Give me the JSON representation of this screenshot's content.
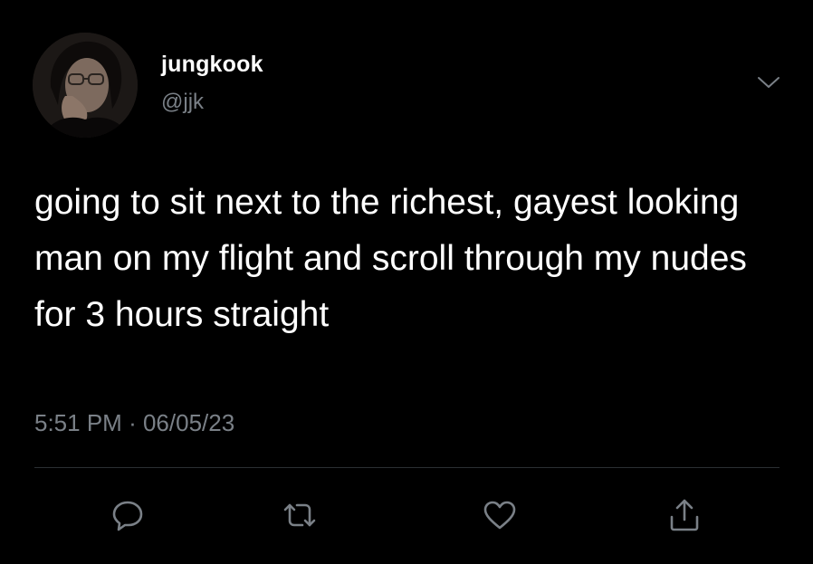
{
  "user": {
    "name": "jungkook",
    "handle": "@jjk",
    "avatar_icon": "profile-photo"
  },
  "tweet": {
    "text": "going to sit next to the richest, gayest looking man on my flight and scroll through my nudes for 3 hours straight",
    "time": "5:51 PM",
    "separator": "·",
    "date": "06/05/23"
  },
  "actions": [
    {
      "name": "reply",
      "icon": "speech-bubble-icon"
    },
    {
      "name": "retweet",
      "icon": "retweet-arrows-icon"
    },
    {
      "name": "like",
      "icon": "heart-icon"
    },
    {
      "name": "share",
      "icon": "share-upload-icon"
    }
  ],
  "colors": {
    "background": "#000000",
    "primary_text": "#ffffff",
    "secondary_text": "#7a8087",
    "icon": "#7a8087",
    "divider": "#2b2f33"
  }
}
